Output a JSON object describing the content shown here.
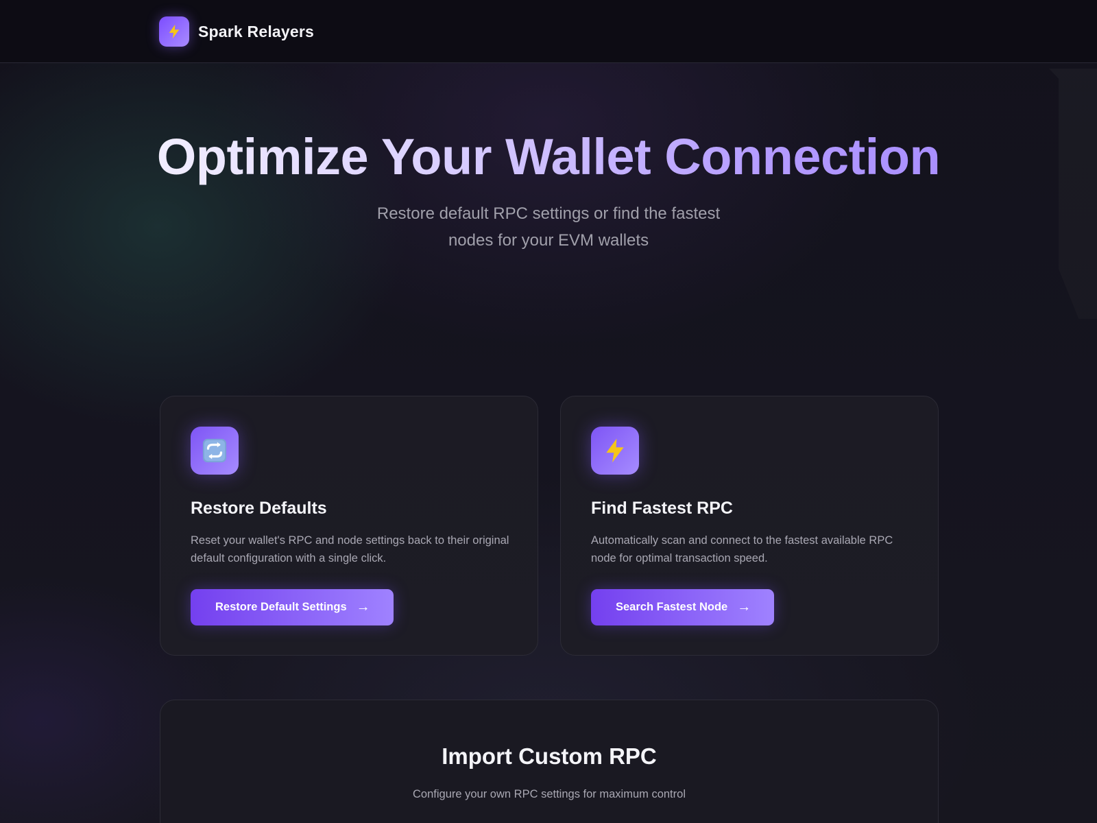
{
  "header": {
    "brand_name": "Spark Relayers",
    "logo_icon": "lightning-icon"
  },
  "hero": {
    "title": "Optimize Your Wallet Connection",
    "subtitle": "Restore default RPC settings or find the fastest nodes for your EVM wallets"
  },
  "cards": [
    {
      "icon": "refresh-icon",
      "title": "Restore Defaults",
      "description": "Reset your wallet's RPC and node settings back to their original default configuration with a single click.",
      "button_label": "Restore Default Settings",
      "button_arrow": "→"
    },
    {
      "icon": "lightning-icon",
      "title": "Find Fastest RPC",
      "description": "Automatically scan and connect to the fastest available RPC node for optimal transaction speed.",
      "button_label": "Search Fastest Node",
      "button_arrow": "→"
    }
  ],
  "import": {
    "title": "Import Custom RPC",
    "subtitle": "Configure your own RPC settings for maximum control"
  },
  "colors": {
    "accent_start": "#7440ef",
    "accent_end": "#a68cff",
    "background": "#15141f",
    "card": "#1c1b24",
    "lightning": "#f5c518"
  }
}
